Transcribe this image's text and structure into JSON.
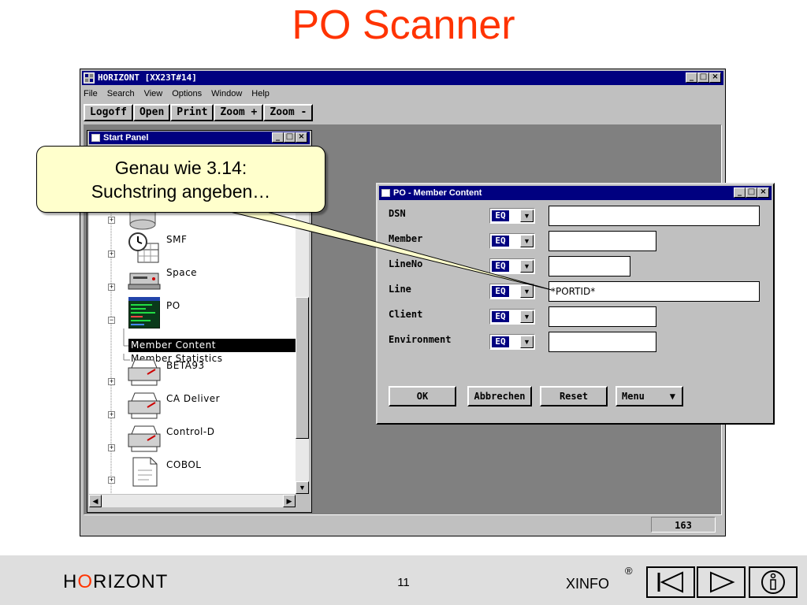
{
  "slide": {
    "title": "PO Scanner",
    "footer": {
      "logo_pre": "H",
      "logo_o": "O",
      "logo_post": "RIZONT",
      "page_number": "11",
      "xinfo": "XINFO",
      "registered": "®"
    }
  },
  "main_window": {
    "title": "HORIZONT [XX23T#14]",
    "menu": [
      "File",
      "Search",
      "View",
      "Options",
      "Window",
      "Help"
    ],
    "toolbar": [
      "Logoff",
      "Open",
      "Print",
      "Zoom +",
      "Zoom -"
    ],
    "status_count": "163"
  },
  "start_panel": {
    "title": "Start Panel",
    "tree": [
      {
        "label": "SMF"
      },
      {
        "label": "Space"
      },
      {
        "label": "PO"
      },
      {
        "label": "BETA93"
      },
      {
        "label": "CA Deliver"
      },
      {
        "label": "Control-D"
      },
      {
        "label": "COBOL"
      }
    ],
    "po_children": [
      "Member Content",
      "Member Statistics"
    ],
    "selected": "Member Content"
  },
  "dialog": {
    "title": "PO - Member Content",
    "fields": [
      {
        "label": "DSN",
        "operator": "EQ",
        "value": ""
      },
      {
        "label": "Member",
        "operator": "EQ",
        "value": ""
      },
      {
        "label": "LineNo",
        "operator": "EQ",
        "value": ""
      },
      {
        "label": "Line",
        "operator": "EQ",
        "value": "*PORTID*"
      },
      {
        "label": "Client",
        "operator": "EQ",
        "value": ""
      },
      {
        "label": "Environment",
        "operator": "EQ",
        "value": ""
      }
    ],
    "buttons": {
      "ok": "OK",
      "cancel": "Abbrechen",
      "reset": "Reset",
      "menu": "Menu"
    }
  },
  "callout": {
    "line1": "Genau wie 3.14:",
    "line2": "Suchstring angeben…"
  },
  "colors": {
    "title_red": "#ff3300",
    "window_blue": "#000080",
    "callout_yellow": "#ffffcc"
  }
}
